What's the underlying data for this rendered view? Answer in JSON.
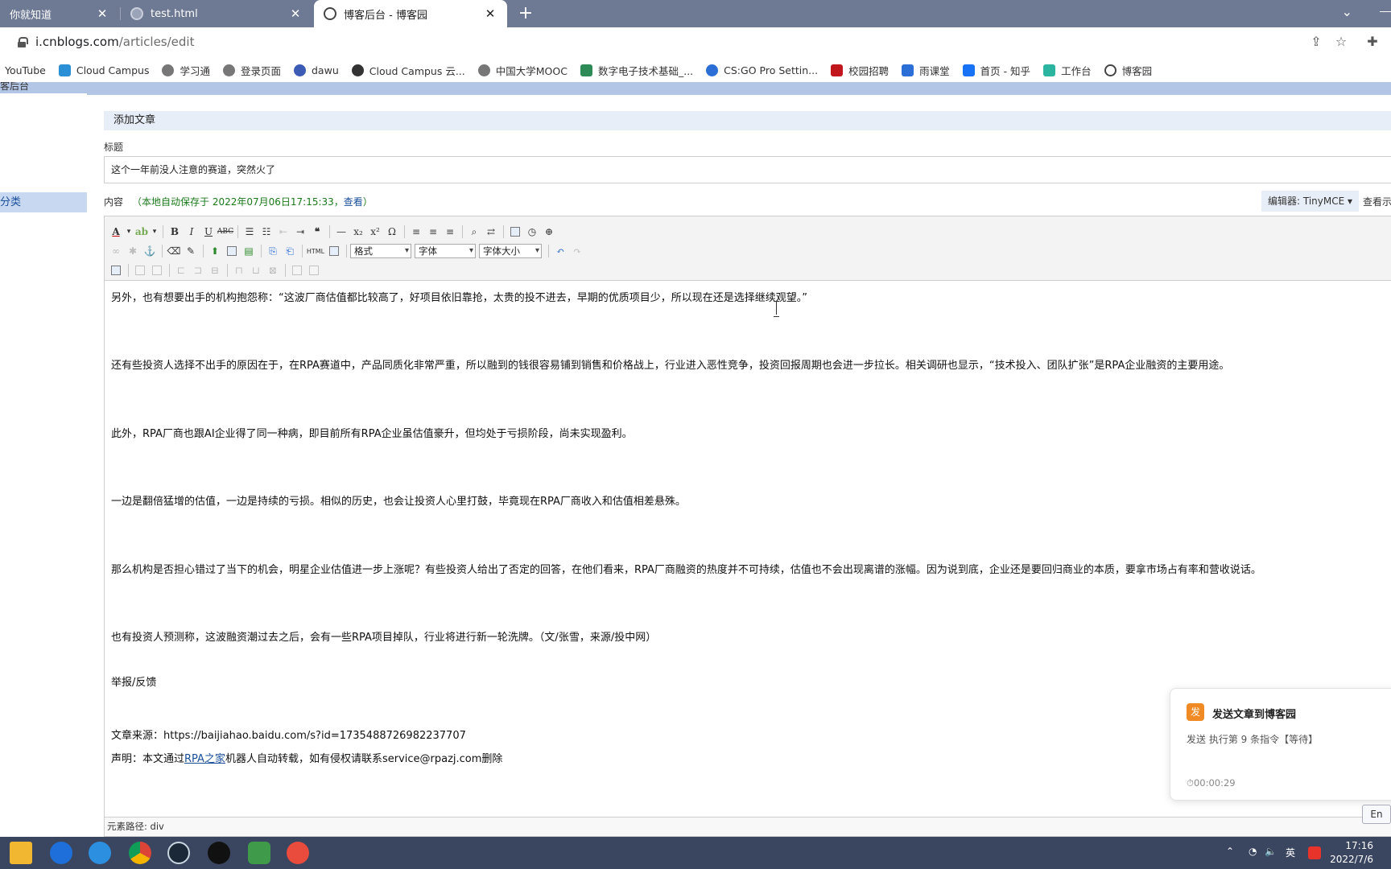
{
  "browser": {
    "tabs": [
      {
        "title": "你就知道"
      },
      {
        "title": "test.html"
      },
      {
        "title": "博客后台 - 博客园"
      }
    ],
    "new_tab_label": "+",
    "url_host": "i.cnblogs.com",
    "url_path": "/articles/edit",
    "bookmarks": [
      {
        "label": "YouTube",
        "color": "#ffffff"
      },
      {
        "label": "Cloud Campus",
        "color": "#2b8fd6"
      },
      {
        "label": "学习通",
        "color": "#555555"
      },
      {
        "label": "登录页面",
        "color": "#555555"
      },
      {
        "label": "dawu",
        "color": "#3b5bb5"
      },
      {
        "label": "Cloud Campus 云...",
        "color": "#333333"
      },
      {
        "label": "中国大学MOOC",
        "color": "#555555"
      },
      {
        "label": "数字电子技术基础_...",
        "color": "#2e8b57"
      },
      {
        "label": "CS:GO Pro Settin...",
        "color": "#2b6fd6"
      },
      {
        "label": "校园招聘",
        "color": "#c0161c"
      },
      {
        "label": "雨课堂",
        "color": "#2b6fd6"
      },
      {
        "label": "首页 - 知乎",
        "color": "#1772f6"
      },
      {
        "label": "工作台",
        "color": "#2bb5a0"
      },
      {
        "label": "博客园",
        "color": "#333333"
      }
    ]
  },
  "page": {
    "left_top_fragment": "客后台",
    "left_nav_category": "分类",
    "section_title": "添加文章",
    "title_label": "标题",
    "title_value": "这个一年前没人注意的赛道，突然火了",
    "content_label": "内容",
    "autosave_text": "（本地自动保存于 2022年07月06日17:15:33，",
    "autosave_link": "查看",
    "autosave_close": "）",
    "editor_switch": "编辑器: TinyMCE ▾",
    "preview_link": "查看示"
  },
  "editor": {
    "format_select": "格式",
    "font_select": "字体",
    "size_select": "字体大小",
    "html_button": "HTML",
    "paragraphs": [
      "另外，也有想要出手的机构抱怨称：“这波厂商估值都比较高了，好项目依旧靠抢，太贵的投不进去，早期的优质项目少，所以现在还是选择继续观望。”",
      "还有些投资人选择不出手的原因在于，在RPA赛道中，产品同质化非常严重，所以融到的钱很容易铺到销售和价格战上，行业进入恶性竞争，投资回报周期也会进一步拉长。相关调研也显示，“技术投入、团队扩张”是RPA企业融资的主要用途。",
      "此外，RPA厂商也跟AI企业得了同一种病，即目前所有RPA企业虽估值豪升，但均处于亏损阶段，尚未实现盈利。",
      "一边是翻倍猛增的估值，一边是持续的亏损。相似的历史，也会让投资人心里打鼓，毕竟现在RPA厂商收入和估值相差悬殊。",
      "那么机构是否担心错过了当下的机会，明星企业估值进一步上涨呢？有些投资人给出了否定的回答，在他们看来，RPA厂商融资的热度并不可持续，估值也不会出现离谱的涨幅。因为说到底，企业还是要回归商业的本质，要拿市场占有率和营收说话。",
      "也有投资人预测称，这波融资潮过去之后，会有一些RPA项目掉队，行业将进行新一轮洗牌。（文/张雪，来源/投中网）",
      "举报/反馈"
    ],
    "source_line": "文章来源：https://baijiahao.baidu.com/s?id=1735488726982237707",
    "statement_prefix": "声明：本文通过",
    "statement_link": "RPA之家",
    "statement_suffix": "机器人自动转载，如有侵权请联系service@rpazj.com删除",
    "status_path": "元素路径: div"
  },
  "notification": {
    "icon_char": "发",
    "title": "发送文章到博客园",
    "status": "发送 执行第 9 条指令【等待】",
    "timer": "⏱00:00:29"
  },
  "lang_chip": "En",
  "taskbar": {
    "tray_ime": "英",
    "time": "17:16",
    "date": "2022/7/6"
  },
  "colors": {
    "tabstrip": "#6e7a94",
    "taskbar": "#3a4560",
    "top_band": "#b4c6e6",
    "autosave_green": "#1a7a1a",
    "link_blue": "#1a4f9c",
    "notice_orange": "#f08a24"
  }
}
